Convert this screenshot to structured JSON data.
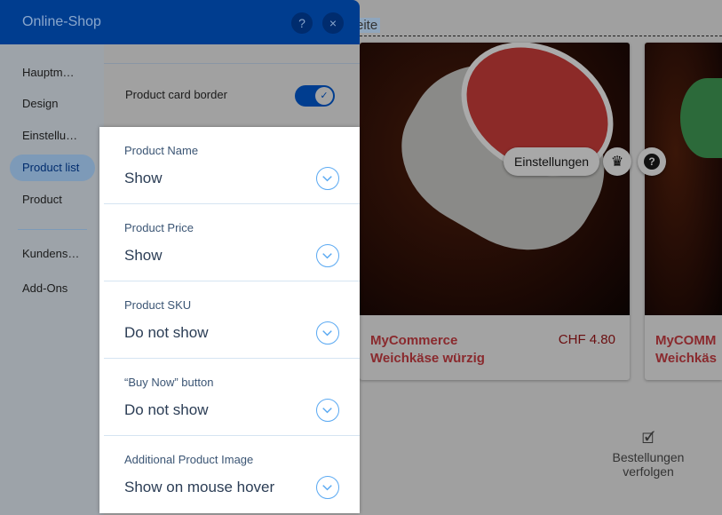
{
  "site": {
    "page_link": "eite",
    "product": {
      "name_line1": "MyCommerce",
      "name_line2": "Weichkäse würzig",
      "price": "CHF 4.80"
    },
    "product2": {
      "name_line1": "MyCOMM",
      "name_line2": "Weichkäs"
    },
    "settings_button": "Einstellungen",
    "orders": {
      "line1": "Bestellungen",
      "line2": "verfolgen"
    }
  },
  "panel": {
    "title": "Online-Shop",
    "help": "?",
    "close": "×",
    "nav": [
      {
        "label": "Hauptm…"
      },
      {
        "label": "Design"
      },
      {
        "label": "Einstellu…"
      },
      {
        "label": "Product list",
        "active": true
      },
      {
        "label": "Product"
      },
      {
        "label": "Kundens…"
      },
      {
        "label": "Add-Ons"
      }
    ],
    "toggle": {
      "label": "Product card border",
      "on": true
    },
    "options": [
      {
        "label": "Product Name",
        "value": "Show"
      },
      {
        "label": "Product Price",
        "value": "Show"
      },
      {
        "label": "Product SKU",
        "value": "Do not show"
      },
      {
        "label": "“Buy Now” button",
        "value": "Do not show"
      },
      {
        "label": "Additional Product Image",
        "value": "Show on mouse hover"
      }
    ]
  },
  "colors": {
    "brand": "#003d8f",
    "accent": "#5aa9f2",
    "product_name": "#8a2a2e"
  }
}
